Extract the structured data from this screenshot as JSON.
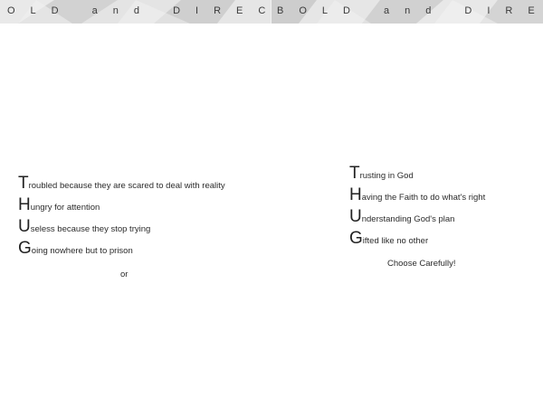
{
  "header": {
    "left_text": "OLD and DIRECT",
    "right_text": "BOLD and DIREC"
  },
  "left_acrostic": [
    {
      "letter": "T",
      "rest": "roubled because they are scared to deal with reality"
    },
    {
      "letter": "H",
      "rest": "ungry for attention"
    },
    {
      "letter": "U",
      "rest": "seless because they stop trying"
    },
    {
      "letter": "G",
      "rest": "oing nowhere but to prison"
    }
  ],
  "or_text": "or",
  "right_acrostic": [
    {
      "letter": "T",
      "rest": "rusting in God"
    },
    {
      "letter": "H",
      "rest": "aving the Faith to do what's right"
    },
    {
      "letter": "U",
      "rest": "nderstanding  God's plan"
    },
    {
      "letter": "G",
      "rest": "ifted like no other"
    }
  ],
  "closing_text": "Choose Carefully!",
  "colors": {
    "band_base": "#dcdcdc",
    "text": "#2b2b2b"
  }
}
